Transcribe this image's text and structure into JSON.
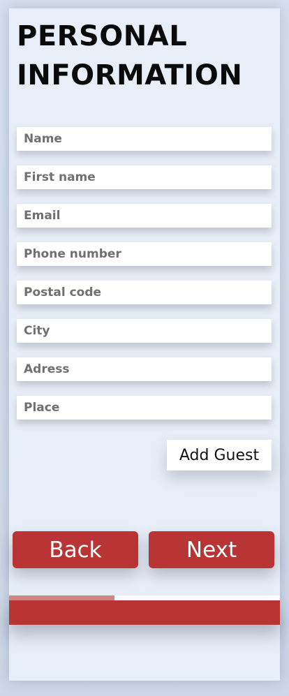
{
  "header": {
    "title": "PERSONAL INFORMATION"
  },
  "form": {
    "fields": [
      {
        "placeholder": "Name"
      },
      {
        "placeholder": "First name"
      },
      {
        "placeholder": "Email"
      },
      {
        "placeholder": "Phone number"
      },
      {
        "placeholder": "Postal code"
      },
      {
        "placeholder": "City"
      },
      {
        "placeholder": "Adress"
      },
      {
        "placeholder": "Place"
      }
    ],
    "add_guest_label": "Add Guest"
  },
  "nav": {
    "back_label": "Back",
    "next_label": "Next"
  },
  "progress": {
    "fraction": 0.39
  },
  "colors": {
    "accent": "#b93535",
    "progress_fill": "#d98585",
    "panel": "#e8eef7"
  }
}
